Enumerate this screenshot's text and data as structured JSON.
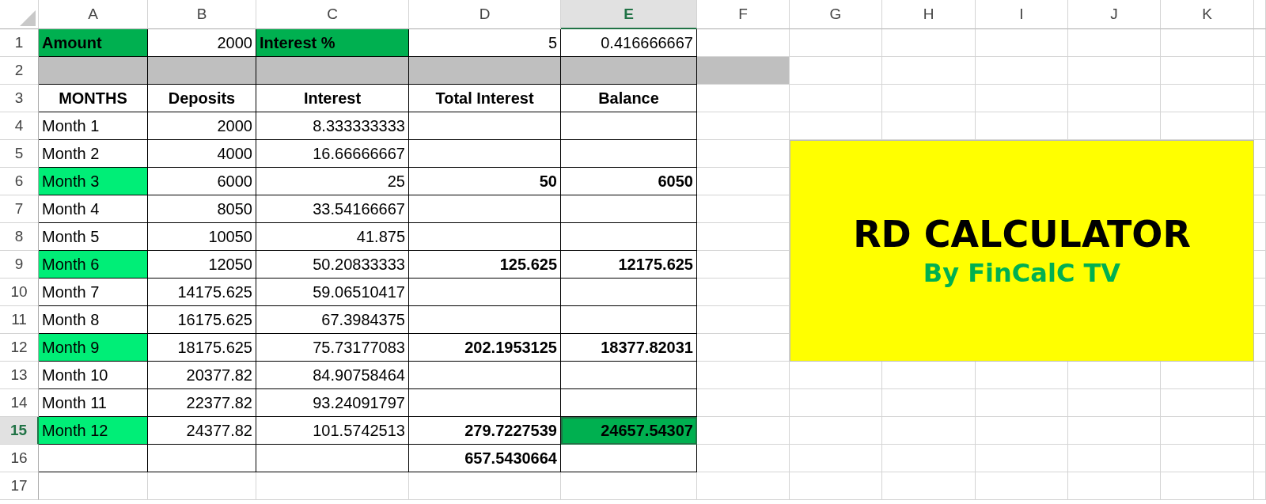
{
  "columns": [
    {
      "label": "A",
      "selected": false
    },
    {
      "label": "B",
      "selected": false
    },
    {
      "label": "C",
      "selected": false
    },
    {
      "label": "D",
      "selected": false
    },
    {
      "label": "E",
      "selected": true
    },
    {
      "label": "F",
      "selected": false
    },
    {
      "label": "G",
      "selected": false
    },
    {
      "label": "H",
      "selected": false
    },
    {
      "label": "I",
      "selected": false
    },
    {
      "label": "J",
      "selected": false
    },
    {
      "label": "K",
      "selected": false
    }
  ],
  "rows": [
    {
      "number": "1",
      "selected": false,
      "cells": [
        {
          "text": "Amount",
          "kind": "label",
          "bold": true,
          "color": "#00b050",
          "selected": false
        },
        {
          "text": "2000",
          "kind": "number",
          "bold": false,
          "selected": false
        },
        {
          "text": "Interest %",
          "kind": "label",
          "bold": true,
          "color": "#00b050",
          "selected": false
        },
        {
          "text": "5",
          "kind": "number",
          "bold": false,
          "selected": false
        },
        {
          "text": "0.416666667",
          "kind": "number",
          "bold": false,
          "selected": false
        }
      ]
    },
    {
      "number": "2",
      "selected": false,
      "cells": [
        {
          "kind": "fill",
          "color": "#bfbfbf",
          "selected": false
        },
        {
          "kind": "fill",
          "color": "#bfbfbf",
          "selected": false
        },
        {
          "kind": "fill",
          "color": "#bfbfbf",
          "selected": false
        },
        {
          "kind": "fill",
          "color": "#bfbfbf",
          "selected": false
        },
        {
          "kind": "fill",
          "color": "#bfbfbf",
          "selected": false
        },
        {
          "kind": "fill",
          "color": "#bfbfbf",
          "selected": false
        }
      ]
    },
    {
      "number": "3",
      "selected": false,
      "cells": [
        {
          "text": "MONTHS",
          "kind": "header",
          "bold": true,
          "selected": false
        },
        {
          "text": "Deposits",
          "kind": "header",
          "bold": true,
          "selected": false
        },
        {
          "text": "Interest",
          "kind": "header",
          "bold": true,
          "selected": false
        },
        {
          "text": "Total Interest",
          "kind": "header",
          "bold": true,
          "selected": false
        },
        {
          "text": "Balance",
          "kind": "header",
          "bold": true,
          "selected": false
        }
      ]
    },
    {
      "number": "4",
      "selected": false,
      "cells": [
        {
          "text": "Month 1",
          "kind": "label",
          "bold": false,
          "selected": false
        },
        {
          "text": "2000",
          "kind": "number",
          "bold": false,
          "selected": false
        },
        {
          "text": "8.333333333",
          "kind": "number",
          "bold": false,
          "selected": false
        }
      ]
    },
    {
      "number": "5",
      "selected": false,
      "cells": [
        {
          "text": "Month 2",
          "kind": "label",
          "bold": false,
          "selected": false
        },
        {
          "text": "4000",
          "kind": "number",
          "bold": false,
          "selected": false
        },
        {
          "text": "16.66666667",
          "kind": "number",
          "bold": false,
          "selected": false
        }
      ]
    },
    {
      "number": "6",
      "selected": false,
      "cells": [
        {
          "text": "Month 3",
          "kind": "label",
          "bold": false,
          "color": "#00ee77",
          "selected": false
        },
        {
          "text": "6000",
          "kind": "number",
          "bold": false,
          "selected": false
        },
        {
          "text": "25",
          "kind": "number",
          "bold": false,
          "selected": false
        },
        {
          "text": "50",
          "kind": "number",
          "bold": true,
          "selected": false
        },
        {
          "text": "6050",
          "kind": "number",
          "bold": true,
          "selected": false
        }
      ]
    },
    {
      "number": "7",
      "selected": false,
      "cells": [
        {
          "text": "Month 4",
          "kind": "label",
          "bold": false,
          "selected": false
        },
        {
          "text": "8050",
          "kind": "number",
          "bold": false,
          "selected": false
        },
        {
          "text": "33.54166667",
          "kind": "number",
          "bold": false,
          "selected": false
        }
      ]
    },
    {
      "number": "8",
      "selected": false,
      "cells": [
        {
          "text": "Month 5",
          "kind": "label",
          "bold": false,
          "selected": false
        },
        {
          "text": "10050",
          "kind": "number",
          "bold": false,
          "selected": false
        },
        {
          "text": "41.875",
          "kind": "number",
          "bold": false,
          "selected": false
        }
      ]
    },
    {
      "number": "9",
      "selected": false,
      "cells": [
        {
          "text": "Month 6",
          "kind": "label",
          "bold": false,
          "color": "#00ee77",
          "selected": false
        },
        {
          "text": "12050",
          "kind": "number",
          "bold": false,
          "selected": false
        },
        {
          "text": "50.20833333",
          "kind": "number",
          "bold": false,
          "selected": false
        },
        {
          "text": "125.625",
          "kind": "number",
          "bold": true,
          "selected": false
        },
        {
          "text": "12175.625",
          "kind": "number",
          "bold": true,
          "selected": false
        }
      ]
    },
    {
      "number": "10",
      "selected": false,
      "cells": [
        {
          "text": "Month 7",
          "kind": "label",
          "bold": false,
          "selected": false
        },
        {
          "text": "14175.625",
          "kind": "number",
          "bold": false,
          "selected": false
        },
        {
          "text": "59.06510417",
          "kind": "number",
          "bold": false,
          "selected": false
        }
      ]
    },
    {
      "number": "11",
      "selected": false,
      "cells": [
        {
          "text": "Month 8",
          "kind": "label",
          "bold": false,
          "selected": false
        },
        {
          "text": "16175.625",
          "kind": "number",
          "bold": false,
          "selected": false
        },
        {
          "text": "67.3984375",
          "kind": "number",
          "bold": false,
          "selected": false
        }
      ]
    },
    {
      "number": "12",
      "selected": false,
      "cells": [
        {
          "text": "Month 9",
          "kind": "label",
          "bold": false,
          "color": "#00ee77",
          "selected": false
        },
        {
          "text": "18175.625",
          "kind": "number",
          "bold": false,
          "selected": false
        },
        {
          "text": "75.73177083",
          "kind": "number",
          "bold": false,
          "selected": false
        },
        {
          "text": "202.1953125",
          "kind": "number",
          "bold": true,
          "selected": false
        },
        {
          "text": "18377.82031",
          "kind": "number",
          "bold": true,
          "selected": false
        }
      ]
    },
    {
      "number": "13",
      "selected": false,
      "cells": [
        {
          "text": "Month 10",
          "kind": "label",
          "bold": false,
          "selected": false
        },
        {
          "text": "20377.82",
          "kind": "number",
          "bold": false,
          "selected": false
        },
        {
          "text": "84.90758464",
          "kind": "number",
          "bold": false,
          "selected": false
        }
      ]
    },
    {
      "number": "14",
      "selected": false,
      "cells": [
        {
          "text": "Month 11",
          "kind": "label",
          "bold": false,
          "selected": false
        },
        {
          "text": "22377.82",
          "kind": "number",
          "bold": false,
          "selected": false
        },
        {
          "text": "93.24091797",
          "kind": "number",
          "bold": false,
          "selected": false
        }
      ]
    },
    {
      "number": "15",
      "selected": true,
      "cells": [
        {
          "text": "Month 12",
          "kind": "label",
          "bold": false,
          "color": "#00ee77",
          "selected": false
        },
        {
          "text": "24377.82",
          "kind": "number",
          "bold": false,
          "selected": false
        },
        {
          "text": "101.5742513",
          "kind": "number",
          "bold": false,
          "selected": false
        },
        {
          "text": "279.7227539",
          "kind": "number",
          "bold": true,
          "selected": false
        },
        {
          "text": "24657.54307",
          "kind": "number",
          "bold": true,
          "color": "#00b050",
          "selected": true
        }
      ]
    },
    {
      "number": "16",
      "selected": false,
      "cells": [
        null,
        null,
        null,
        {
          "text": "657.5430664",
          "kind": "number",
          "bold": true,
          "selected": false
        }
      ]
    },
    {
      "number": "17",
      "selected": false
    }
  ],
  "banner": {
    "title": "RD CALCULATOR",
    "subtitle": "By FinCalC TV"
  }
}
